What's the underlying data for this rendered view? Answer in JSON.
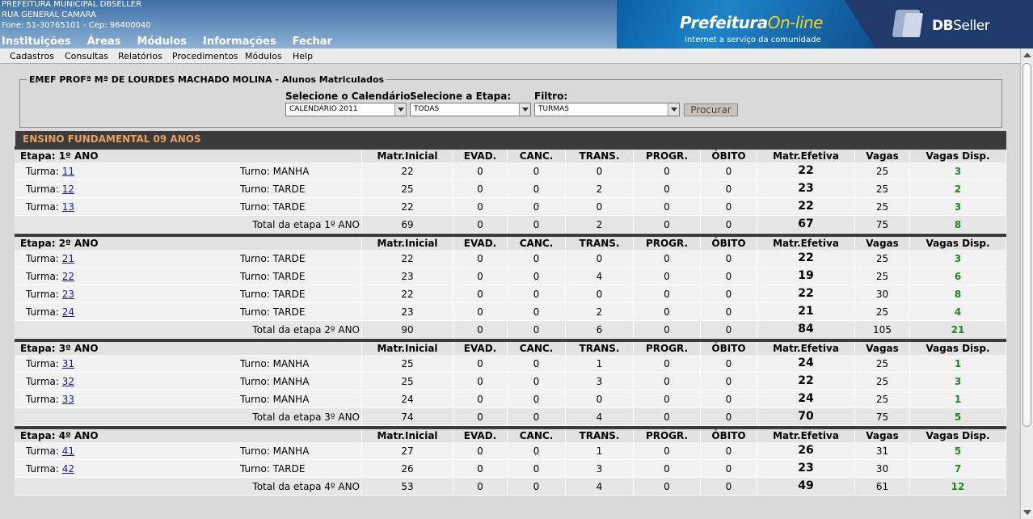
{
  "institution": {
    "name": "PREFEITURA MUNICIPAL DBSELLER",
    "address": "RUA GENERAL CAMARA",
    "contact": "Fone: 51-30765101  -  Cep: 96400040"
  },
  "top_menu": [
    "Instituições",
    "Áreas",
    "Módulos",
    "Informações",
    "Fechar"
  ],
  "brand": {
    "primary": "Prefeitura",
    "secondary": "On-line",
    "tagline": "Internet a serviço da comunidade",
    "company": "DB",
    "company2": "Seller"
  },
  "menubar": [
    "Cadastros",
    "Consultas",
    "Relatórios",
    "Procedimentos",
    "Módulos",
    "Help"
  ],
  "filter": {
    "legend": "EMEF PROFª Mª DE LOURDES MACHADO MOLINA - Alunos Matriculados",
    "calendar_label": "Selecione o Calendário:",
    "calendar_value": "CALENDÁRIO 2011",
    "etapa_label": "Selecione a Etapa:",
    "etapa_value": "TODAS",
    "filtro_label": "Filtro:",
    "filtro_value": "TURMAS",
    "button": "Procurar"
  },
  "section_title": "ENSINO FUNDAMENTAL 09 ANOS",
  "columns": [
    "Matr.Inicial",
    "EVAD.",
    "CANC.",
    "TRANS.",
    "PROGR.",
    "ÓBITO",
    "Matr.Efetiva",
    "Vagas",
    "Vagas Disp."
  ],
  "labels": {
    "turma": "Turma:",
    "turno": "Turno:"
  },
  "etapas": [
    {
      "title": "Etapa: 1º ANO",
      "turmas": [
        {
          "num": "11",
          "turno": "MANHA",
          "vals": [
            "22",
            "0",
            "0",
            "0",
            "0",
            "0",
            "22",
            "25",
            "3"
          ]
        },
        {
          "num": "12",
          "turno": "TARDE",
          "vals": [
            "25",
            "0",
            "0",
            "2",
            "0",
            "0",
            "23",
            "25",
            "2"
          ]
        },
        {
          "num": "13",
          "turno": "TARDE",
          "vals": [
            "22",
            "0",
            "0",
            "0",
            "0",
            "0",
            "22",
            "25",
            "3"
          ]
        }
      ],
      "total_label": "Total da etapa 1º ANO",
      "total": [
        "69",
        "0",
        "0",
        "2",
        "0",
        "0",
        "67",
        "75",
        "8"
      ]
    },
    {
      "title": "Etapa: 2º ANO",
      "turmas": [
        {
          "num": "21",
          "turno": "TARDE",
          "vals": [
            "22",
            "0",
            "0",
            "0",
            "0",
            "0",
            "22",
            "25",
            "3"
          ]
        },
        {
          "num": "22",
          "turno": "TARDE",
          "vals": [
            "23",
            "0",
            "0",
            "4",
            "0",
            "0",
            "19",
            "25",
            "6"
          ]
        },
        {
          "num": "23",
          "turno": "TARDE",
          "vals": [
            "22",
            "0",
            "0",
            "0",
            "0",
            "0",
            "22",
            "30",
            "8"
          ]
        },
        {
          "num": "24",
          "turno": "TARDE",
          "vals": [
            "23",
            "0",
            "0",
            "2",
            "0",
            "0",
            "21",
            "25",
            "4"
          ]
        }
      ],
      "total_label": "Total da etapa 2º ANO",
      "total": [
        "90",
        "0",
        "0",
        "6",
        "0",
        "0",
        "84",
        "105",
        "21"
      ]
    },
    {
      "title": "Etapa: 3º ANO",
      "turmas": [
        {
          "num": "31",
          "turno": "MANHA",
          "vals": [
            "25",
            "0",
            "0",
            "1",
            "0",
            "0",
            "24",
            "25",
            "1"
          ]
        },
        {
          "num": "32",
          "turno": "MANHA",
          "vals": [
            "25",
            "0",
            "0",
            "3",
            "0",
            "0",
            "22",
            "25",
            "3"
          ]
        },
        {
          "num": "33",
          "turno": "MANHA",
          "vals": [
            "24",
            "0",
            "0",
            "0",
            "0",
            "0",
            "24",
            "25",
            "1"
          ]
        }
      ],
      "total_label": "Total da etapa 3º ANO",
      "total": [
        "74",
        "0",
        "0",
        "4",
        "0",
        "0",
        "70",
        "75",
        "5"
      ]
    },
    {
      "title": "Etapa: 4º ANO",
      "turmas": [
        {
          "num": "41",
          "turno": "MANHA",
          "vals": [
            "27",
            "0",
            "0",
            "1",
            "0",
            "0",
            "26",
            "31",
            "5"
          ]
        },
        {
          "num": "42",
          "turno": "TARDE",
          "vals": [
            "26",
            "0",
            "0",
            "3",
            "0",
            "0",
            "23",
            "30",
            "7"
          ]
        }
      ],
      "total_label": "Total da etapa 4º ANO",
      "total": [
        "53",
        "0",
        "0",
        "4",
        "0",
        "0",
        "49",
        "61",
        "12"
      ]
    }
  ]
}
